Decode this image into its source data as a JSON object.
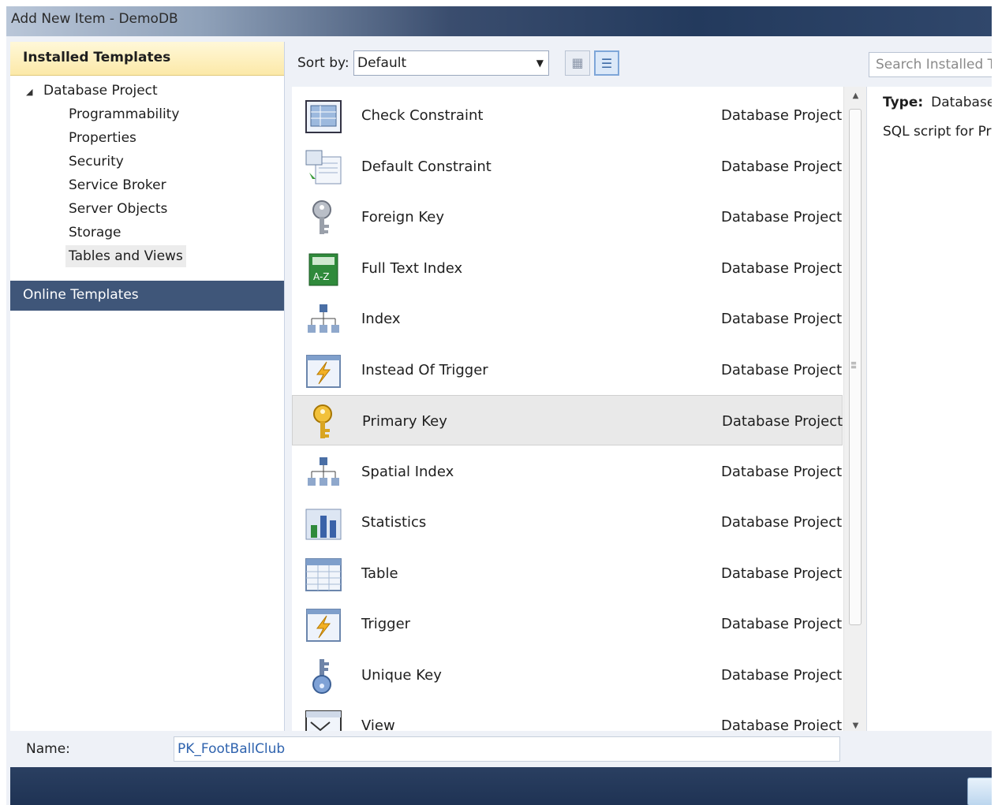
{
  "window": {
    "title": "Add New Item - DemoDB"
  },
  "left_pane": {
    "installed_label": "Installed Templates",
    "tree_root": "Database Project",
    "tree_children": [
      "Programmability",
      "Properties",
      "Security",
      "Service Broker",
      "Server Objects",
      "Storage",
      "Tables and Views"
    ],
    "selected_child": "Tables and Views",
    "online_label": "Online Templates"
  },
  "toolbar": {
    "sort_label": "Sort by:",
    "sort_value": "Default",
    "search_placeholder": "Search Installed Te"
  },
  "items": [
    {
      "name": "Check Constraint",
      "category": "Database Project",
      "icon": "check-constraint-icon"
    },
    {
      "name": "Default Constraint",
      "category": "Database Project",
      "icon": "default-constraint-icon"
    },
    {
      "name": "Foreign Key",
      "category": "Database Project",
      "icon": "foreign-key-icon"
    },
    {
      "name": "Full Text Index",
      "category": "Database Project",
      "icon": "full-text-index-icon"
    },
    {
      "name": "Index",
      "category": "Database Project",
      "icon": "index-icon"
    },
    {
      "name": "Instead Of Trigger",
      "category": "Database Project",
      "icon": "trigger-icon"
    },
    {
      "name": "Primary Key",
      "category": "Database Project",
      "icon": "primary-key-icon",
      "selected": true
    },
    {
      "name": "Spatial Index",
      "category": "Database Project",
      "icon": "spatial-index-icon"
    },
    {
      "name": "Statistics",
      "category": "Database Project",
      "icon": "statistics-icon"
    },
    {
      "name": "Table",
      "category": "Database Project",
      "icon": "table-icon"
    },
    {
      "name": "Trigger",
      "category": "Database Project",
      "icon": "trigger-icon"
    },
    {
      "name": "Unique Key",
      "category": "Database Project",
      "icon": "unique-key-icon"
    },
    {
      "name": "View",
      "category": "Database Project",
      "icon": "view-icon"
    }
  ],
  "details": {
    "type_label": "Type:",
    "type_value": "Database",
    "description": "SQL script for Pri"
  },
  "name_field": {
    "label": "Name:",
    "value": "PK_FootBallClub"
  },
  "colors": {
    "online_header": "#3f5679",
    "installed_header": "#fce9a8",
    "selection": "#e9e9e9",
    "link_blue": "#2f63ae"
  }
}
